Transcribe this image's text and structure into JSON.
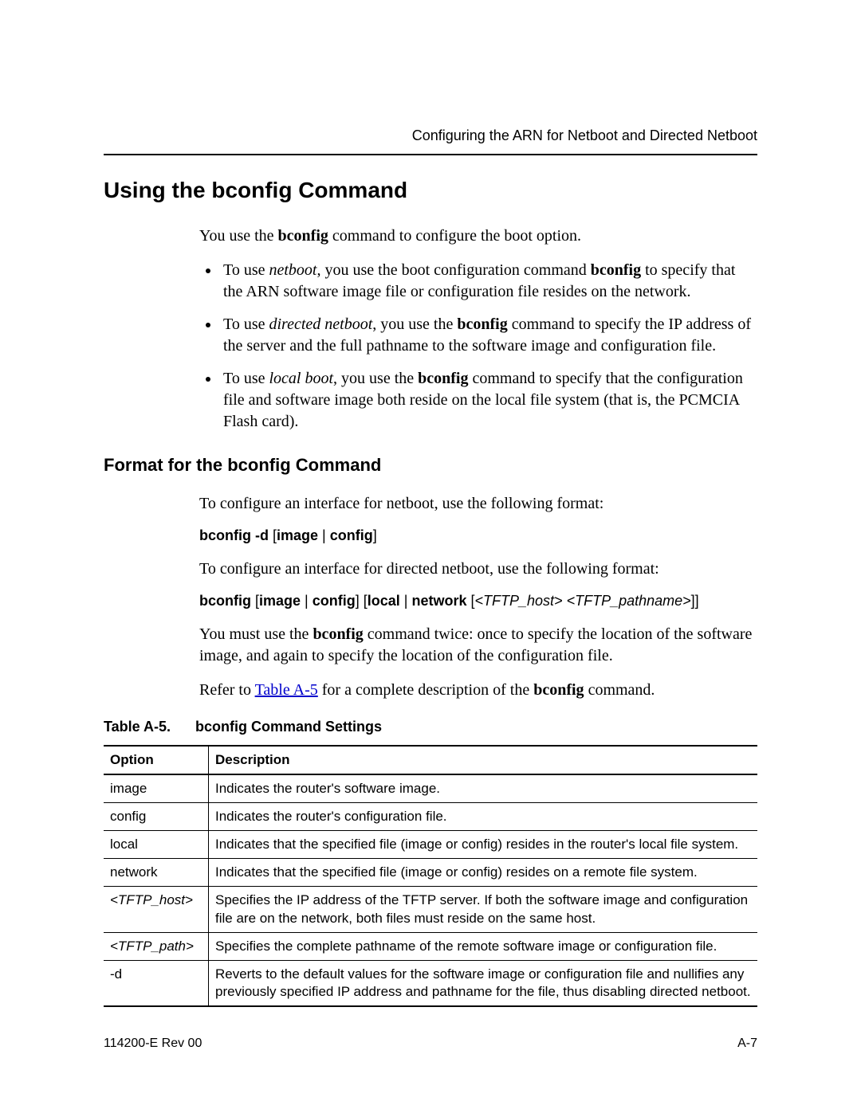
{
  "header": {
    "chapter": "Configuring the ARN for Netboot and Directed Netboot"
  },
  "section": {
    "title": "Using the bconfig Command"
  },
  "intro": {
    "pre": "You use the ",
    "cmd": "bconfig",
    "post": " command to configure the boot option."
  },
  "bullets": [
    {
      "pre": "To use ",
      "em": "netboot",
      "mid1": ", you use the boot configuration command ",
      "b1": "bconfig",
      "mid2": " to specify that the ARN software image file or configuration file resides on the network.",
      "post": ""
    },
    {
      "pre": "To use ",
      "em": "directed netboot",
      "mid1": ", you use the ",
      "b1": "bconfig",
      "mid2": " command to specify the IP address of the server and the full pathname to the software image and configuration file.",
      "post": ""
    },
    {
      "pre": "To use ",
      "em": "local boot",
      "mid1": ", you use the ",
      "b1": "bconfig",
      "mid2": " command to specify that the configuration file and software image both reside on the local file system (that is, the PCMCIA Flash card).",
      "post": ""
    }
  ],
  "subsection": {
    "title": "Format for the bconfig Command"
  },
  "fmt": {
    "p1": "To configure an interface for netboot, use the following format:",
    "cmd1": {
      "b1": "bconfig -d",
      "sp": "  [",
      "b2": "image",
      "pipe": " | ",
      "b3": "config",
      "close": "]"
    },
    "p2": "To configure an interface for directed netboot, use the following format:",
    "cmd2": {
      "b1": "bconfig",
      "t1": " [",
      "b2": "image",
      "pipe1": " | ",
      "b3": "config",
      "t2": "] [",
      "b4": "local",
      "pipe2": " | ",
      "b5": "network",
      "t3": " [",
      "i1": "<TFTP_host>",
      "sp": " ",
      "i2": "<TFTP_pathname>",
      "t4": "]]"
    },
    "p3a": "You must use the ",
    "p3b": "bconfig",
    "p3c": " command twice: once to specify the location of the software image, and again to specify the location of the configuration file.",
    "p4a": "Refer to ",
    "p4link": "Table A-5",
    "p4b": " for a complete description of the ",
    "p4c": "bconfig",
    "p4d": " command."
  },
  "table": {
    "caption_num": "Table A-5.",
    "caption_title": "bconfig Command Settings",
    "head": {
      "c1": "Option",
      "c2": "Description"
    },
    "rows": [
      {
        "opt": "image",
        "italic": false,
        "desc": "Indicates the router's software image."
      },
      {
        "opt": "config",
        "italic": false,
        "desc": "Indicates the router's configuration file."
      },
      {
        "opt": "local",
        "italic": false,
        "desc": "Indicates that the specified file (image or config) resides in the router's local file system."
      },
      {
        "opt": "network",
        "italic": false,
        "desc": "Indicates that the specified file (image or config) resides on a remote file system."
      },
      {
        "opt": "<TFTP_host>",
        "italic": true,
        "desc": "Specifies the IP address of the TFTP server. If both the software image and configuration file are on the network, both files must reside on the same host."
      },
      {
        "opt": "<TFTP_path>",
        "italic": true,
        "desc": "Specifies the complete pathname of the remote software image or configuration file."
      },
      {
        "opt": "-d",
        "italic": false,
        "desc": "Reverts to the default values for the software image or configuration file and nullifies any previously specified IP address and pathname for the file, thus disabling directed netboot."
      }
    ]
  },
  "footer": {
    "left": "114200-E Rev 00",
    "right": "A-7"
  }
}
